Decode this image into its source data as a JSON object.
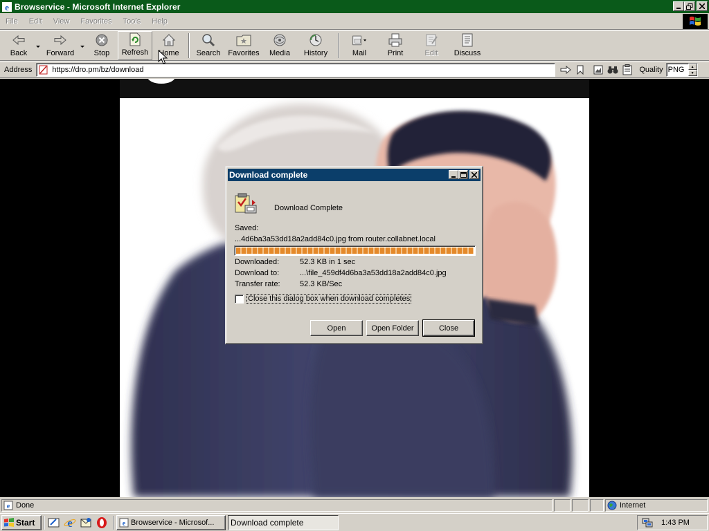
{
  "window": {
    "title": "Browservice - Microsoft Internet Explorer"
  },
  "menu": {
    "items": [
      "File",
      "Edit",
      "View",
      "Favorites",
      "Tools",
      "Help"
    ]
  },
  "toolbar": {
    "back": "Back",
    "forward": "Forward",
    "stop": "Stop",
    "refresh": "Refresh",
    "home": "Home",
    "search": "Search",
    "favorites": "Favorites",
    "media": "Media",
    "history": "History",
    "mail": "Mail",
    "print": "Print",
    "edit": "Edit",
    "discuss": "Discuss"
  },
  "addressbar": {
    "label": "Address",
    "url": "https://dro.pm/bz/download",
    "quality_label": "Quality",
    "quality_value": "PNG"
  },
  "dialog": {
    "title": "Download complete",
    "heading": "Download Complete",
    "saved_label": "Saved:",
    "saved_file": "...4d6ba3a53dd18a2add84c0.jpg from router.collabnet.local",
    "progress": 1.0,
    "downloaded_label": "Downloaded:",
    "downloaded_value": "52.3 KB in 1 sec",
    "download_to_label": "Download to:",
    "download_to_value": "...\\file_459df4d6ba3a53dd18a2add84c0.jpg",
    "transfer_rate_label": "Transfer rate:",
    "transfer_rate_value": "52.3 KB/Sec",
    "close_checkbox_label": "Close this dialog box when download completes",
    "close_checkbox_checked": false,
    "open_button": "Open",
    "open_folder_button": "Open Folder",
    "close_button": "Close"
  },
  "statusbar": {
    "status": "Done",
    "zone": "Internet"
  },
  "taskbar": {
    "start": "Start",
    "tasks": [
      "Browservice - Microsof...",
      "Download complete"
    ],
    "clock": "1:43 PM"
  },
  "colors": {
    "titlebar": "#0a5a1a",
    "dialog_titlebar": "#0b3e6a",
    "progress": "#e4892a",
    "chrome": "#d4d0c8"
  }
}
